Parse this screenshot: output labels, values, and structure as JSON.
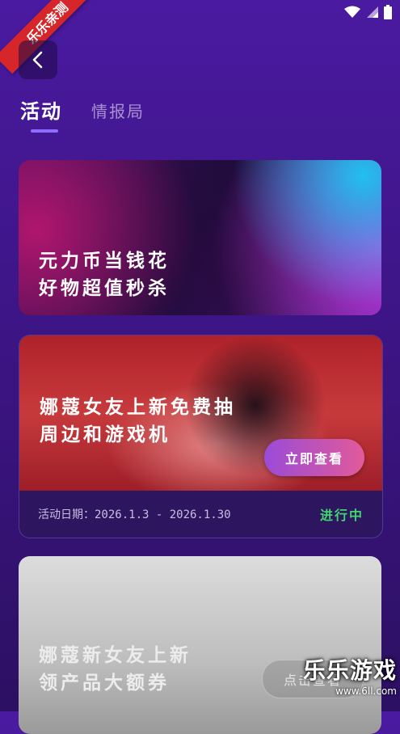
{
  "watermark": {
    "corner_ribbon": "乐乐亲测",
    "brand": "乐乐游戏",
    "url": "www.6ll.com"
  },
  "tabs": [
    {
      "label": "活动",
      "active": true
    },
    {
      "label": "情报局",
      "active": false
    }
  ],
  "cards": [
    {
      "title_line1": "元力币当钱花",
      "title_line2": "好物超值秒杀"
    },
    {
      "title": "娜蔻女友上新免费抽周边和游戏机",
      "button": "立即查看",
      "date": "活动日期：2026.1.3 - 2026.1.30",
      "status": "进行中",
      "status_color": "#3fd66a"
    },
    {
      "title_line1": "娜蔻新女友上新",
      "title_line2": "领产品大额券",
      "button": "点击查看"
    }
  ],
  "colors": {
    "accent": "#8f6cff",
    "cta_start": "#9a4bd8",
    "cta_end": "#e25a9a"
  }
}
